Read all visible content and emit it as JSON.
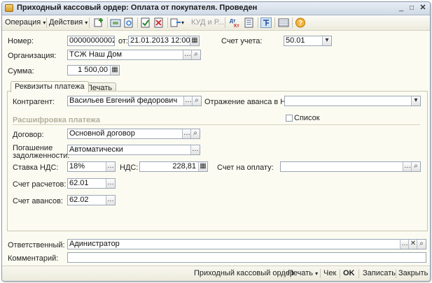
{
  "window": {
    "title": "Приходный кассовый ордер: Оплата от покупателя. Проведен"
  },
  "toolbar": {
    "operation": "Операция",
    "actions": "Действия",
    "kud": "КУД и Р..."
  },
  "header": {
    "number_label": "Номер:",
    "number_value": "00000000002",
    "from_label": "от:",
    "date_value": "21.01.2013 12:00:00",
    "account_label": "Счет учета:",
    "account_value": "50.01",
    "org_label": "Организация:",
    "org_value": "ТСЖ Наш Дом",
    "sum_label": "Сумма:",
    "sum_value": "1 500,00"
  },
  "tabs": [
    {
      "label": "Реквизиты платежа"
    },
    {
      "label": "Печать"
    }
  ],
  "payment": {
    "contractor_label": "Контрагент:",
    "contractor_value": "Васильев Евгений федорович",
    "advance_label": "Отражение аванса в НУ:",
    "advance_value": "",
    "section_title": "Расшифровка платежа",
    "list_label": "Список",
    "contract_label": "Договор:",
    "contract_value": "Основной договор",
    "debt_label_1": "Погашение",
    "debt_label_2": "задолженности:",
    "debt_value": "Автоматически",
    "vat_rate_label": "Ставка НДС:",
    "vat_rate_value": "18%",
    "vat_label": "НДС:",
    "vat_value": "228,81",
    "invoice_label": "Счет на оплату:",
    "invoice_value": "",
    "settle_label": "Счет расчетов:",
    "settle_value": "62.01",
    "adv_acc_label": "Счет авансов:",
    "adv_acc_value": "62.02"
  },
  "footer": {
    "responsible_label": "Ответственный:",
    "responsible_value": "Адиниcтратор",
    "comment_label": "Комментарий:",
    "comment_value": ""
  },
  "bottombar": {
    "receipt": "Приходный кассовый ордер",
    "print": "Печать",
    "check": "Чек",
    "ok": "OK",
    "save": "Записать",
    "close": "Закрыть"
  }
}
